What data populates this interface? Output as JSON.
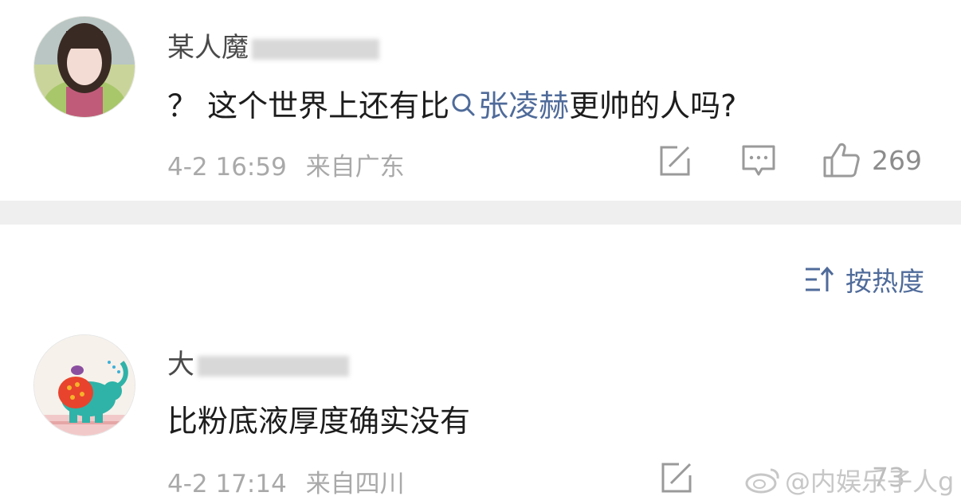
{
  "comments": [
    {
      "username": "某人魔",
      "text_prefix": "？ 这个世界上还有比",
      "topic": "张凌赫",
      "text_suffix": "更帅的人吗?",
      "time": "4-2 16:59",
      "location": "来自广东",
      "likes": "269"
    },
    {
      "username": "大",
      "text": "比粉底液厚度确实没有",
      "time": "4-2 17:14",
      "location": "来自四川",
      "likes": "73"
    }
  ],
  "sort": {
    "label": "按热度"
  },
  "watermark": {
    "text": "@内娱乐子人g"
  },
  "colors": {
    "link": "#4f6b9a",
    "meta": "#a9a9a9",
    "divider": "#efefef"
  }
}
